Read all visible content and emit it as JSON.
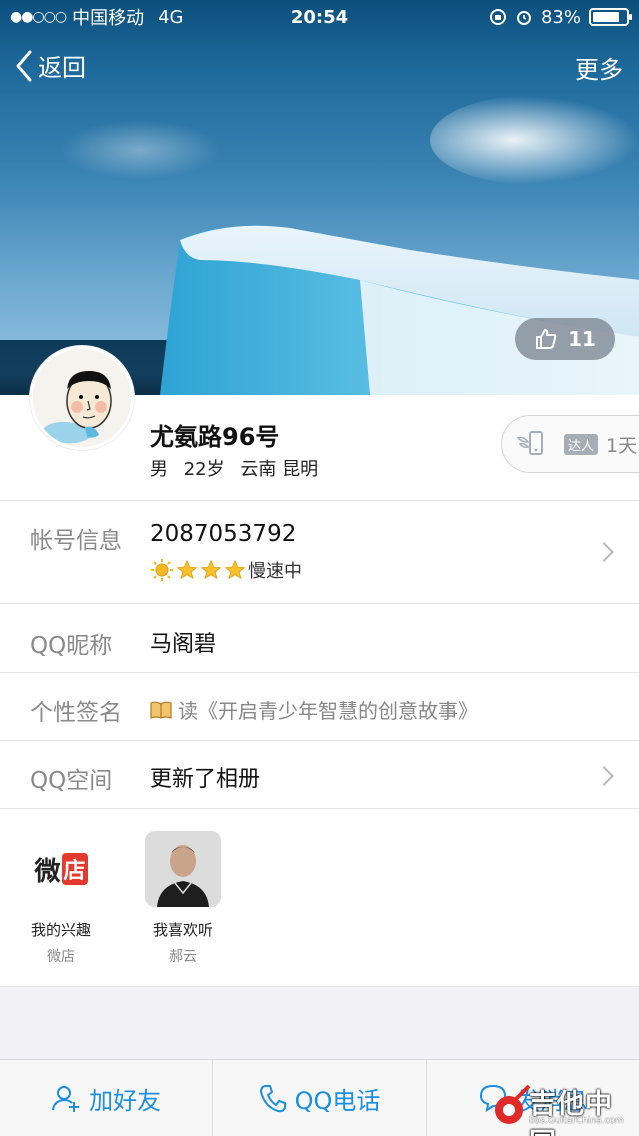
{
  "status_bar": {
    "signal_dots": "●●○○○",
    "carrier": "中国移动",
    "network": "4G",
    "time": "20:54",
    "battery_percent": "83%",
    "battery_level": 0.83
  },
  "nav": {
    "back_label": "返回",
    "more_label": "更多"
  },
  "cover": {
    "like_count": "11"
  },
  "profile": {
    "name": "尤氨路96号",
    "gender": "男",
    "age": "22岁",
    "location": "云南 昆明",
    "talent_badge": "达人",
    "talent_days": "1天"
  },
  "info": {
    "account_label": "帐号信息",
    "account_value": "2087053792",
    "level_text": "慢速中",
    "nickname_label": "QQ昵称",
    "nickname_value": "马阁碧",
    "signature_label": "个性签名",
    "signature_value": "读《开启青少年智慧的创意故事》",
    "qzone_label": "QQ空间",
    "qzone_value": "更新了相册"
  },
  "interests": [
    {
      "title": "我的兴趣",
      "subtitle": "微店",
      "icon_text": "微",
      "icon_text2": "店"
    },
    {
      "title": "我喜欢听",
      "subtitle": "郝云"
    }
  ],
  "bottom_bar": {
    "add_friend": "加好友",
    "qq_call": "QQ电话",
    "send_message": "发消息"
  },
  "watermark": {
    "title": "吉他中国",
    "url": "bbs.GuitarChina.com"
  },
  "colors": {
    "accent": "#1d8fe0",
    "label_gray": "#8a8a8a"
  }
}
